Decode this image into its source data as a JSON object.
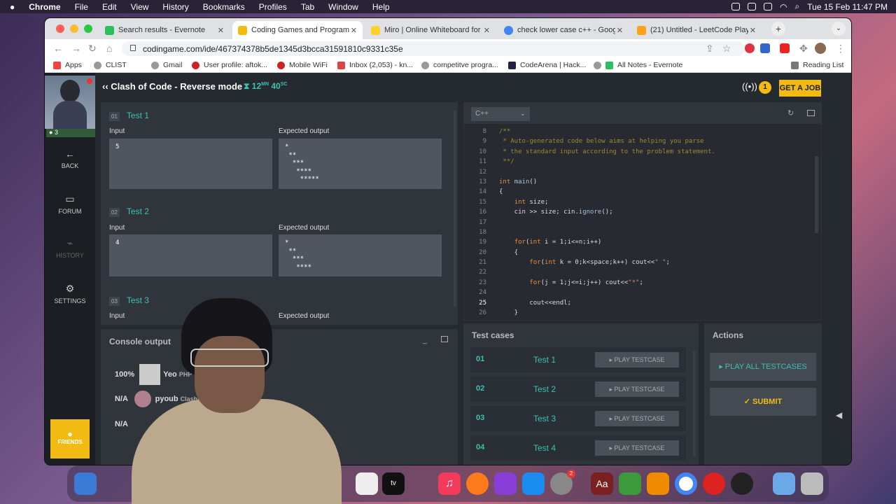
{
  "menubar": {
    "apple": "",
    "items": [
      "Chrome",
      "File",
      "Edit",
      "View",
      "History",
      "Bookmarks",
      "Profiles",
      "Tab",
      "Window",
      "Help"
    ],
    "datetime": "Tue 15 Feb  11:47 PM"
  },
  "browser": {
    "tabs": [
      {
        "title": "Search results - Evernote",
        "favicon": "#2dbe60"
      },
      {
        "title": "Coding Games and Programmi",
        "favicon": "#f2bb13"
      },
      {
        "title": "Miro | Online Whiteboard for Vi",
        "favicon": "#ffd02f"
      },
      {
        "title": "check lower case c++ - Google",
        "favicon": "#4285f4"
      },
      {
        "title": "(21) Untitled - LeetCode Playg",
        "favicon": "#ffa116"
      }
    ],
    "url": "codingame.com/ide/467374378b5de1345d3bcca31591810c9331c35e",
    "bookmarks": [
      "Apps",
      "CLIST",
      "Gmail",
      "User profile: aftok...",
      "Mobile WiFi",
      "Inbox (2,053) - kn...",
      "competitve progra...",
      "CodeArena | Hack...",
      "All Notes - Evernote",
      "Reading List"
    ]
  },
  "app": {
    "title": "Clash of Code - Reverse mode",
    "timer_mn": "12",
    "timer_mn_unit": "MN",
    "timer_sc": "40",
    "timer_sc_unit": "SC",
    "badge_count": "1",
    "get_job": "GET A JOB",
    "level": "3",
    "nav": {
      "back": "BACK",
      "forum": "FORUM",
      "history": "HISTORY",
      "settings": "SETTINGS",
      "friends": "FRIENDS"
    },
    "tests": [
      {
        "num": "01",
        "name": "Test 1",
        "input_label": "Input",
        "output_label": "Expected output",
        "input": "5",
        "output": "*\n **\n  ***\n   ****\n    *****"
      },
      {
        "num": "02",
        "name": "Test 2",
        "input_label": "Input",
        "output_label": "Expected output",
        "input": "4",
        "output": "*\n **\n  ***\n   ****"
      },
      {
        "num": "03",
        "name": "Test 3",
        "input_label": "Input",
        "output_label": "Expected output",
        "input": "",
        "output": ""
      }
    ],
    "console": {
      "title": "Console output",
      "rows": [
        {
          "pct": "100%",
          "name": "Yeo",
          "lang": "PHP"
        },
        {
          "pct": "N/A",
          "name": "pyoub",
          "lang": "Clashi"
        },
        {
          "pct": "N/A",
          "name": "",
          "lang": ""
        }
      ]
    },
    "editor": {
      "language": "C++",
      "lines": [
        {
          "n": "8",
          "html": "<span class='cm'>/**</span>"
        },
        {
          "n": "9",
          "html": "<span class='cm'> * Auto-generated code below aims at helping you parse</span>"
        },
        {
          "n": "10",
          "html": "<span class='cm'> * the standard input according to the problem statement.</span>"
        },
        {
          "n": "11",
          "html": "<span class='cm'> **/</span>"
        },
        {
          "n": "12",
          "html": ""
        },
        {
          "n": "13",
          "html": "<span class='kw'>int</span> <span class='fn'>main</span>()"
        },
        {
          "n": "14",
          "html": "{"
        },
        {
          "n": "15",
          "html": "    <span class='kw'>int</span> size;"
        },
        {
          "n": "16",
          "html": "    cin &gt;&gt; size; cin.<span class='fn'>ignore</span>();"
        },
        {
          "n": "17",
          "html": ""
        },
        {
          "n": "18",
          "html": ""
        },
        {
          "n": "19",
          "html": "    <span class='kw'>for</span>(<span class='kw'>int</span> i = 1;i&lt;=n;i++)"
        },
        {
          "n": "20",
          "html": "    {"
        },
        {
          "n": "21",
          "html": "        <span class='kw'>for</span>(<span class='kw'>int</span> k = 0;k&lt;space;k++) cout&lt;&lt;<span class='str'>\" \"</span>;"
        },
        {
          "n": "22",
          "html": ""
        },
        {
          "n": "23",
          "html": "        <span class='kw'>for</span>(j = 1;j&lt;=i;j++) cout&lt;&lt;<span class='str'>\"*\"</span>;"
        },
        {
          "n": "24",
          "html": ""
        },
        {
          "n": "25",
          "html": "        cout&lt;&lt;endl;"
        },
        {
          "n": "26",
          "html": "    }"
        }
      ]
    },
    "testcases": {
      "title": "Test cases",
      "play": "▸ PLAY TESTCASE",
      "items": [
        {
          "num": "01",
          "name": "Test 1"
        },
        {
          "num": "02",
          "name": "Test 2"
        },
        {
          "num": "03",
          "name": "Test 3"
        },
        {
          "num": "04",
          "name": "Test 4"
        }
      ]
    },
    "actions": {
      "title": "Actions",
      "play_all": "▸ PLAY ALL TESTCASES",
      "submit": "✓  SUBMIT"
    }
  },
  "dock": {
    "notification_badge": "2"
  }
}
